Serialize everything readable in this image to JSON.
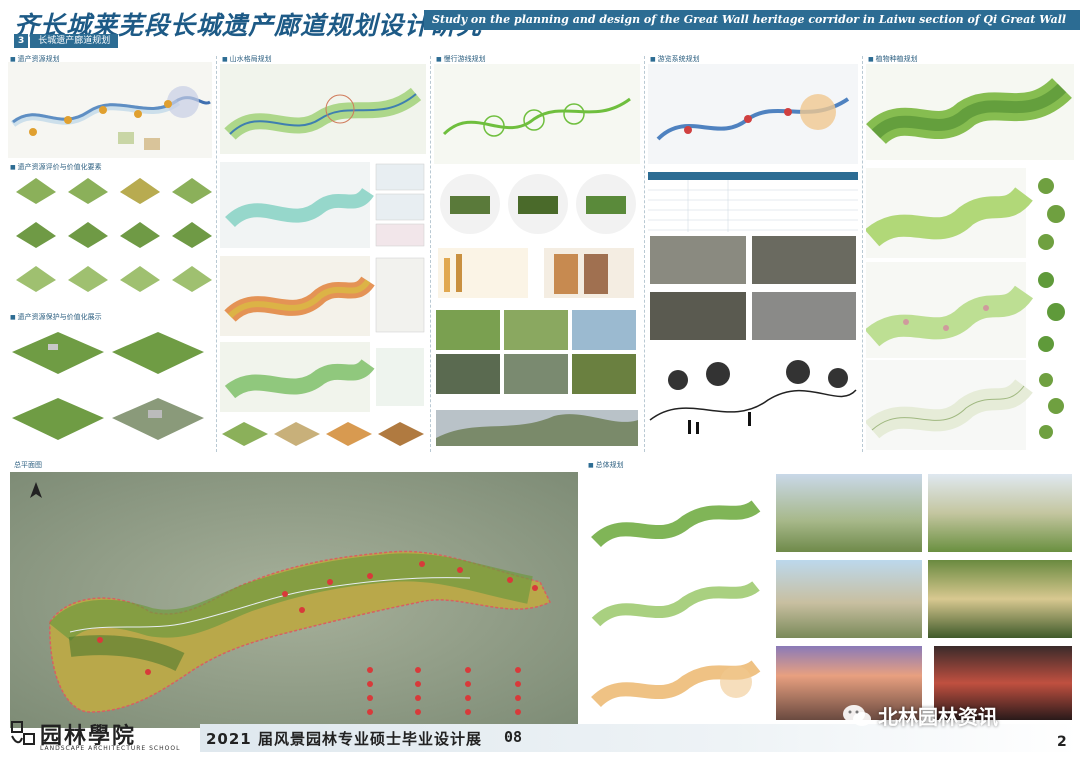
{
  "header": {
    "title_cn": "齐长城莱芜段长城遗产廊道规划设计研究",
    "title_en": "Study on the planning and design of the Great Wall heritage corridor in Laiwu section of Qi Great Wall",
    "section_number": "3",
    "section_label": "长城遗产廊道规划"
  },
  "panels": {
    "heritage": {
      "title": "遗产资源规划",
      "sub1": "遗产资源评价与价值化要素",
      "sub2": "遗产资源保护与价值化展示"
    },
    "ecology": {
      "title": "山水格局规划"
    },
    "greenway": {
      "title": "慢行游线规划"
    },
    "cultural": {
      "title": "游览系统规划"
    },
    "plants": {
      "title": "植物种植规划"
    }
  },
  "master_plan": {
    "title": "总平面图"
  },
  "bottom_right": {
    "title": "总体规划"
  },
  "footer": {
    "logo_cn": "园林學院",
    "logo_en": "LANDSCAPE ARCHITECTURE SCHOOL",
    "expo_title": "2021 届风景园林专业硕士毕业设计展",
    "expo_number": "08",
    "page_number": "2"
  },
  "watermark": {
    "text": "北林园林资讯"
  },
  "colors": {
    "brand_blue": "#2c6c93",
    "title_blue": "#1d5a86",
    "forest_green": "#4f8a3a",
    "corridor_green": "#8fc46a"
  }
}
